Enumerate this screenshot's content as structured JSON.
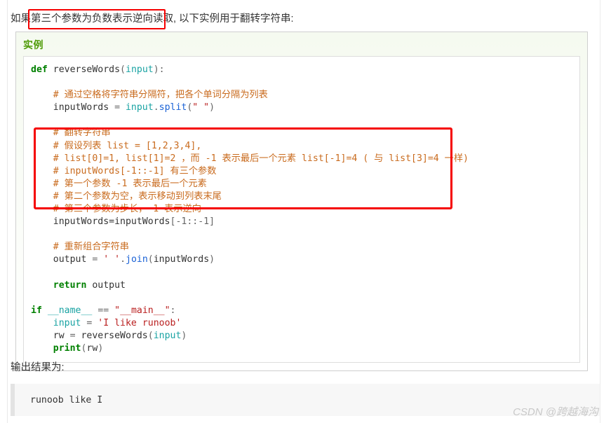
{
  "page": {
    "intro_prefix": "如果",
    "intro_highlight": "第三个参数为负数表示逆向读取,",
    "intro_suffix": " 以下实例用于翻转字符串:",
    "after_code_text": "输出结果为:",
    "watermark": "CSDN @跨越海沟"
  },
  "example": {
    "header_label": "实例"
  },
  "code": {
    "lines": [
      {
        "tokens": [
          {
            "t": "def",
            "c": "k"
          },
          {
            "t": " reverseWords",
            "c": "fn"
          },
          {
            "t": "(",
            "c": "op"
          },
          {
            "t": "input",
            "c": "arg"
          },
          {
            "t": "):",
            "c": "op"
          }
        ]
      },
      {
        "tokens": []
      },
      {
        "tokens": [
          {
            "t": "    # 通过空格将字符串分隔符，把各个单词分隔为列表",
            "c": "cmt"
          }
        ]
      },
      {
        "tokens": [
          {
            "t": "    inputWords ",
            "c": "fn"
          },
          {
            "t": "= ",
            "c": "op"
          },
          {
            "t": "input",
            "c": "arg"
          },
          {
            "t": ".",
            "c": "op"
          },
          {
            "t": "split",
            "c": "mth"
          },
          {
            "t": "(",
            "c": "op"
          },
          {
            "t": "\" \"",
            "c": "str"
          },
          {
            "t": ")",
            "c": "op"
          }
        ]
      },
      {
        "tokens": []
      },
      {
        "tokens": [
          {
            "t": "    # 翻转字符串",
            "c": "cmt"
          }
        ]
      },
      {
        "tokens": [
          {
            "t": "    # 假设列表 list = [1,2,3,4],",
            "c": "cmt"
          }
        ]
      },
      {
        "tokens": [
          {
            "t": "    # list[0]=1, list[1]=2 ，而 -1 表示最后一个元素 list[-1]=4 ( 与 list[3]=4 一样)",
            "c": "cmt"
          }
        ]
      },
      {
        "tokens": [
          {
            "t": "    # inputWords[-1::-1] 有三个参数",
            "c": "cmt"
          }
        ]
      },
      {
        "tokens": [
          {
            "t": "    # 第一个参数 -1 表示最后一个元素",
            "c": "cmt"
          }
        ]
      },
      {
        "tokens": [
          {
            "t": "    # 第二个参数为空，表示移动到列表末尾",
            "c": "cmt"
          }
        ]
      },
      {
        "tokens": [
          {
            "t": "    # 第三个参数为步长，-1 表示逆向",
            "c": "cmt"
          }
        ]
      },
      {
        "tokens": [
          {
            "t": "    inputWords=inputWords",
            "c": "fn"
          },
          {
            "t": "[",
            "c": "op"
          },
          {
            "t": "-1",
            "c": "num"
          },
          {
            "t": "::",
            "c": "op"
          },
          {
            "t": "-1",
            "c": "num"
          },
          {
            "t": "]",
            "c": "op"
          }
        ]
      },
      {
        "tokens": []
      },
      {
        "tokens": [
          {
            "t": "    # 重新组合字符串",
            "c": "cmt"
          }
        ]
      },
      {
        "tokens": [
          {
            "t": "    output ",
            "c": "fn"
          },
          {
            "t": "= ",
            "c": "op"
          },
          {
            "t": "' '",
            "c": "str"
          },
          {
            "t": ".",
            "c": "op"
          },
          {
            "t": "join",
            "c": "mth"
          },
          {
            "t": "(",
            "c": "op"
          },
          {
            "t": "inputWords",
            "c": "fn"
          },
          {
            "t": ")",
            "c": "op"
          }
        ]
      },
      {
        "tokens": []
      },
      {
        "tokens": [
          {
            "t": "    ",
            "c": "op"
          },
          {
            "t": "return",
            "c": "k"
          },
          {
            "t": " output",
            "c": "fn"
          }
        ]
      },
      {
        "tokens": []
      },
      {
        "tokens": [
          {
            "t": "if",
            "c": "k"
          },
          {
            "t": " ",
            "c": "op"
          },
          {
            "t": "__name__",
            "c": "dun"
          },
          {
            "t": " == ",
            "c": "op"
          },
          {
            "t": "\"__main__\"",
            "c": "str"
          },
          {
            "t": ":",
            "c": "op"
          }
        ]
      },
      {
        "tokens": [
          {
            "t": "    ",
            "c": "op"
          },
          {
            "t": "input",
            "c": "arg"
          },
          {
            "t": " = ",
            "c": "op"
          },
          {
            "t": "'I like runoob'",
            "c": "str"
          }
        ]
      },
      {
        "tokens": [
          {
            "t": "    rw ",
            "c": "fn"
          },
          {
            "t": "= ",
            "c": "op"
          },
          {
            "t": "reverseWords",
            "c": "fn"
          },
          {
            "t": "(",
            "c": "op"
          },
          {
            "t": "input",
            "c": "arg"
          },
          {
            "t": ")",
            "c": "op"
          }
        ]
      },
      {
        "tokens": [
          {
            "t": "    ",
            "c": "op"
          },
          {
            "t": "print",
            "c": "k"
          },
          {
            "t": "(",
            "c": "op"
          },
          {
            "t": "rw",
            "c": "fn"
          },
          {
            "t": ")",
            "c": "op"
          }
        ]
      }
    ]
  },
  "output": {
    "text": "runoob like I"
  },
  "annotations": {
    "inline_box_color": "#f50000",
    "block_box_color": "#f50000"
  }
}
